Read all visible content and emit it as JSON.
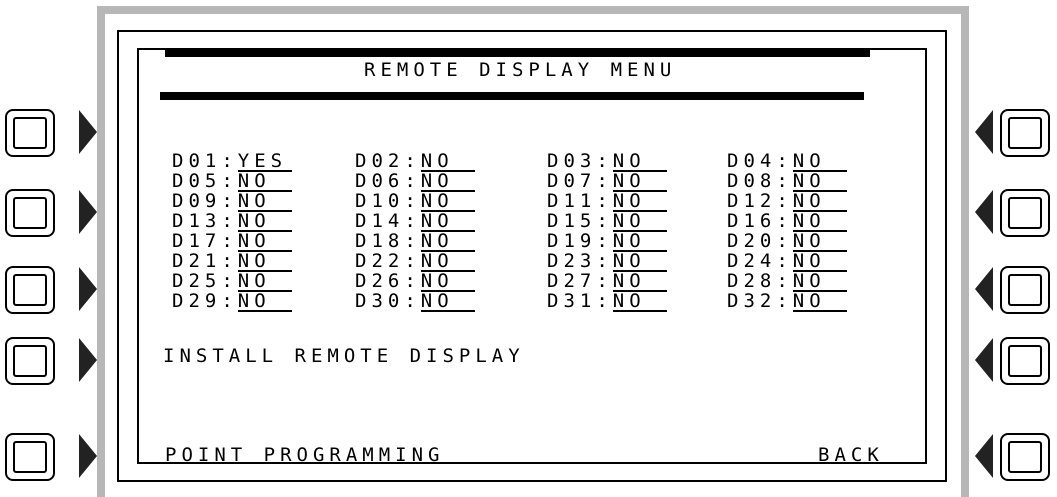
{
  "screen": {
    "title": "REMOTE DISPLAY MENU",
    "displays": [
      {
        "id": "D01",
        "value": "YES"
      },
      {
        "id": "D02",
        "value": "NO"
      },
      {
        "id": "D03",
        "value": "NO"
      },
      {
        "id": "D04",
        "value": "NO"
      },
      {
        "id": "D05",
        "value": "NO"
      },
      {
        "id": "D06",
        "value": "NO"
      },
      {
        "id": "D07",
        "value": "NO"
      },
      {
        "id": "D08",
        "value": "NO"
      },
      {
        "id": "D09",
        "value": "NO"
      },
      {
        "id": "D10",
        "value": "NO"
      },
      {
        "id": "D11",
        "value": "NO"
      },
      {
        "id": "D12",
        "value": "NO"
      },
      {
        "id": "D13",
        "value": "NO"
      },
      {
        "id": "D14",
        "value": "NO"
      },
      {
        "id": "D15",
        "value": "NO"
      },
      {
        "id": "D16",
        "value": "NO"
      },
      {
        "id": "D17",
        "value": "NO"
      },
      {
        "id": "D18",
        "value": "NO"
      },
      {
        "id": "D19",
        "value": "NO"
      },
      {
        "id": "D20",
        "value": "NO"
      },
      {
        "id": "D21",
        "value": "NO"
      },
      {
        "id": "D22",
        "value": "NO"
      },
      {
        "id": "D23",
        "value": "NO"
      },
      {
        "id": "D24",
        "value": "NO"
      },
      {
        "id": "D25",
        "value": "NO"
      },
      {
        "id": "D26",
        "value": "NO"
      },
      {
        "id": "D27",
        "value": "NO"
      },
      {
        "id": "D28",
        "value": "NO"
      },
      {
        "id": "D29",
        "value": "NO"
      },
      {
        "id": "D30",
        "value": "NO"
      },
      {
        "id": "D31",
        "value": "NO"
      },
      {
        "id": "D32",
        "value": "NO"
      }
    ],
    "separator": ":",
    "install_label": "INSTALL REMOTE DISPLAY",
    "point_programming_label": "POINT PROGRAMMING",
    "back_label": "BACK"
  }
}
